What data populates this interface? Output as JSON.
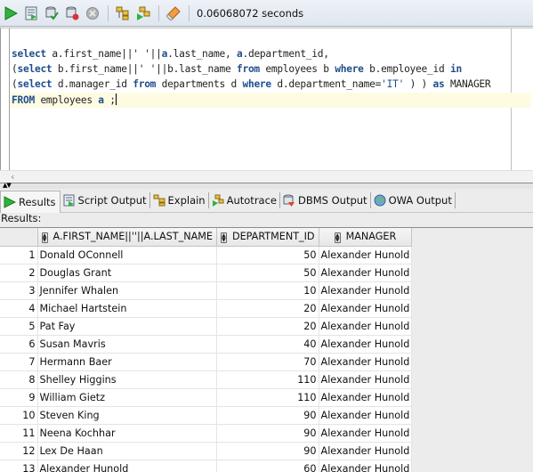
{
  "toolbar": {
    "buttons": [
      {
        "name": "run-statement",
        "icon": "play-icon"
      },
      {
        "name": "run-script",
        "icon": "script-icon"
      },
      {
        "name": "commit",
        "icon": "commit-icon"
      },
      {
        "name": "rollback",
        "icon": "rollback-icon"
      },
      {
        "name": "cancel",
        "icon": "cancel-icon"
      },
      {
        "name": "explain-plan",
        "icon": "explain-icon"
      },
      {
        "name": "autotrace",
        "icon": "autotrace-icon"
      },
      {
        "name": "clear",
        "icon": "eraser-icon"
      }
    ],
    "elapsed": "0.06068072 seconds"
  },
  "editor": {
    "lines": [
      [
        [
          "kw",
          "select"
        ],
        [
          "t",
          " a.first_name||' '||"
        ],
        [
          "kw",
          "a"
        ],
        [
          "t",
          ".last_name, "
        ],
        [
          "kw",
          "a"
        ],
        [
          "t",
          ".department_id,"
        ]
      ],
      [
        [
          "t",
          "("
        ],
        [
          "kw",
          "select"
        ],
        [
          "t",
          " b.first_name||' '||b.last_name "
        ],
        [
          "kw",
          "from"
        ],
        [
          "t",
          " employees b "
        ],
        [
          "kw",
          "where"
        ],
        [
          "t",
          " b.employee_id "
        ],
        [
          "kw",
          "in"
        ]
      ],
      [
        [
          "t",
          "("
        ],
        [
          "kw",
          "select"
        ],
        [
          "t",
          " d.manager_id "
        ],
        [
          "kw",
          "from"
        ],
        [
          "t",
          " departments d "
        ],
        [
          "kw",
          "where"
        ],
        [
          "t",
          " d.department_name="
        ],
        [
          "str",
          "'IT'"
        ],
        [
          "t",
          " ) ) "
        ],
        [
          "kw",
          "as"
        ],
        [
          "t",
          " MANAGER"
        ]
      ],
      [
        [
          "kw",
          "FROM"
        ],
        [
          "t",
          " employees "
        ],
        [
          "kw",
          "a"
        ],
        [
          "t",
          " ;"
        ]
      ]
    ],
    "current_line": 3
  },
  "tabs": [
    {
      "label": "Results",
      "icon": "play-icon",
      "active": true
    },
    {
      "label": "Script Output",
      "icon": "script-icon",
      "active": false
    },
    {
      "label": "Explain",
      "icon": "explain-icon",
      "active": false
    },
    {
      "label": "Autotrace",
      "icon": "autotrace-icon",
      "active": false
    },
    {
      "label": "DBMS Output",
      "icon": "dbms-output-icon",
      "active": false
    },
    {
      "label": "OWA Output",
      "icon": "owa-output-icon",
      "active": false
    }
  ],
  "results_label": "Results:",
  "grid": {
    "columns": [
      "A.FIRST_NAME||''||A.LAST_NAME",
      "DEPARTMENT_ID",
      "MANAGER"
    ],
    "rows": [
      [
        "1",
        "Donald OConnell",
        "50",
        "Alexander Hunold"
      ],
      [
        "2",
        "Douglas Grant",
        "50",
        "Alexander Hunold"
      ],
      [
        "3",
        "Jennifer Whalen",
        "10",
        "Alexander Hunold"
      ],
      [
        "4",
        "Michael Hartstein",
        "20",
        "Alexander Hunold"
      ],
      [
        "5",
        "Pat Fay",
        "20",
        "Alexander Hunold"
      ],
      [
        "6",
        "Susan Mavris",
        "40",
        "Alexander Hunold"
      ],
      [
        "7",
        "Hermann Baer",
        "70",
        "Alexander Hunold"
      ],
      [
        "8",
        "Shelley Higgins",
        "110",
        "Alexander Hunold"
      ],
      [
        "9",
        "William Gietz",
        "110",
        "Alexander Hunold"
      ],
      [
        "10",
        "Steven King",
        "90",
        "Alexander Hunold"
      ],
      [
        "11",
        "Neena Kochhar",
        "90",
        "Alexander Hunold"
      ],
      [
        "12",
        "Lex De Haan",
        "90",
        "Alexander Hunold"
      ],
      [
        "13",
        "Alexander Hunold",
        "60",
        "Alexander Hunold"
      ]
    ]
  }
}
